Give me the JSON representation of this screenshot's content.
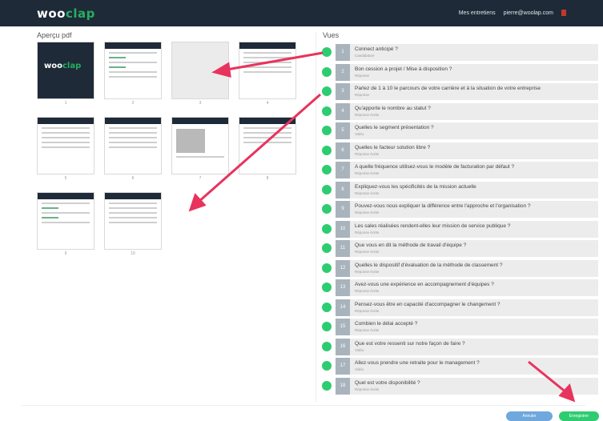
{
  "app": {
    "brand_left": "woo",
    "brand_right": "clap"
  },
  "topnav": {
    "link1": "Mes entretiens",
    "email": "pierre@woolap.com"
  },
  "sections": {
    "left_title": "Aperçu pdf",
    "right_title": "Vues"
  },
  "pages": [
    "1",
    "2",
    "3",
    "4",
    "5",
    "6",
    "7",
    "8",
    "9",
    "10"
  ],
  "questions": [
    {
      "n": "1",
      "text": "Connect anticipé ?",
      "sub": "Candidature"
    },
    {
      "n": "2",
      "text": "Bon cession a projet / Mise à disposition ?",
      "sub": "Réponse"
    },
    {
      "n": "3",
      "text": "Parlez de 1 à 10 le parcours de votre carrière et à la situation de votre entreprise",
      "sub": "Réponse"
    },
    {
      "n": "4",
      "text": "Qu'apporte le nombre au statut ?",
      "sub": "Réponse écrite"
    },
    {
      "n": "5",
      "text": "Quelles le segment présentation ?",
      "sub": "Vidéo"
    },
    {
      "n": "6",
      "text": "Quelles le facteur solution libre ?",
      "sub": "Réponse écrite"
    },
    {
      "n": "7",
      "text": "A quelle fréquence utilisez-vous le modèle de facturation par défaut ?",
      "sub": "Réponse écrite"
    },
    {
      "n": "8",
      "text": "Expliquez-vous les spécificités de la mission actuelle",
      "sub": "Réponse écrite"
    },
    {
      "n": "9",
      "text": "Pouvez-vous nous expliquer la différence entre l'approche et l'organisation ?",
      "sub": "Réponse écrite"
    },
    {
      "n": "10",
      "text": "Les sales réalisées rendent-elles leur mission de service publique ?",
      "sub": "Réponse écrite"
    },
    {
      "n": "11",
      "text": "Que vous en dit la méthode de travail d'équipe ?",
      "sub": "Réponse écrite"
    },
    {
      "n": "12",
      "text": "Quelles le dispositif d'évaluation de la méthode de classement ?",
      "sub": "Réponse écrite"
    },
    {
      "n": "13",
      "text": "Avez-vous une expérience en accompagnement d'équipes ?",
      "sub": "Réponse écrite"
    },
    {
      "n": "14",
      "text": "Pensez-vous être en capacité d'accompagner le changement ?",
      "sub": "Réponse écrite"
    },
    {
      "n": "15",
      "text": "Combien le délai accepté ?",
      "sub": "Réponse écrite"
    },
    {
      "n": "16",
      "text": "Que est votre ressenti sur notre façon de faire ?",
      "sub": "Vidéo"
    },
    {
      "n": "17",
      "text": "Allez-vous prendre une retraite pour le management ?",
      "sub": "Vidéo"
    },
    {
      "n": "18",
      "text": "Quel est votre disponibilité ?",
      "sub": "Réponse écrite"
    }
  ],
  "buttons": {
    "cancel": "Annuler",
    "save": "Enregistrer"
  },
  "colors": {
    "header": "#1e2a38",
    "accent": "#27ae60",
    "arrow": "#e8335c"
  }
}
